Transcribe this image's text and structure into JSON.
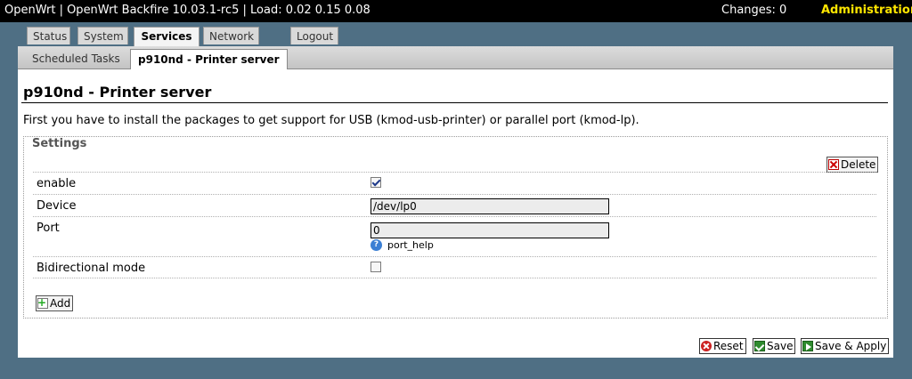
{
  "header": {
    "title": "OpenWrt | OpenWrt Backfire 10.03.1-rc5 | Load: 0.02 0.15 0.08",
    "changes": "Changes: 0",
    "admin": "Administration"
  },
  "main_tabs": [
    {
      "label": "Status"
    },
    {
      "label": "System"
    },
    {
      "label": "Services",
      "active": true
    },
    {
      "label": "Network"
    },
    {
      "label": "Logout"
    }
  ],
  "sub_tabs": [
    {
      "label": "Scheduled Tasks"
    },
    {
      "label": "p910nd - Printer server",
      "active": true
    }
  ],
  "page": {
    "title": "p910nd - Printer server",
    "intro": "First you have to install the packages to get support for USB (kmod-usb-printer) or parallel port (kmod-lp)."
  },
  "settings": {
    "legend": "Settings",
    "delete_label": "Delete",
    "add_label": "Add",
    "enable": {
      "label": "enable",
      "checked": true
    },
    "device": {
      "label": "Device",
      "value": "/dev/lp0"
    },
    "port": {
      "label": "Port",
      "value": "0",
      "help": "port_help"
    },
    "bidirectional": {
      "label": "Bidirectional mode",
      "checked": false
    }
  },
  "actions": {
    "reset": "Reset",
    "save": "Save",
    "save_apply": "Save & Apply"
  },
  "colors": {
    "page_bg": "#4f6f84",
    "admin_accent": "#ffe600"
  }
}
